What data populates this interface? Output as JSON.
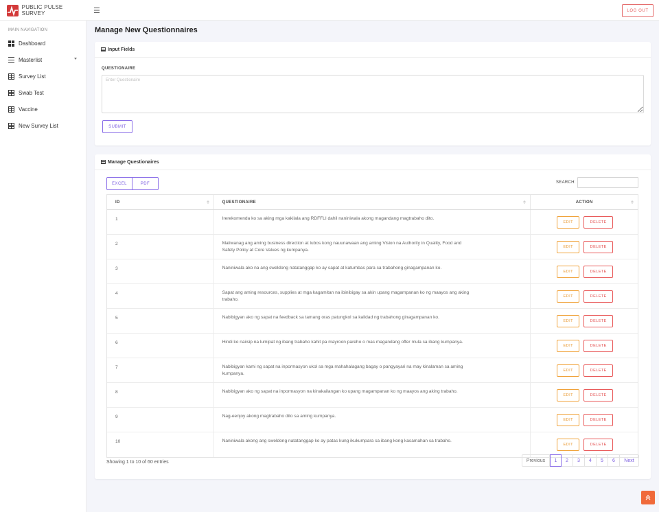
{
  "app": {
    "brand": "PUBLIC PULSE SURVEY",
    "logout_label": "LOG OUT",
    "colors": {
      "accent": "#7a5ce0",
      "brand": "#d33a3a",
      "edit": "#e8952a",
      "delete": "#e34d4d",
      "scroll_top": "#f06a3a"
    }
  },
  "sidebar": {
    "heading": "MAIN NAVIGATION",
    "items": [
      {
        "label": "Dashboard",
        "icon": "dashboard-icon"
      },
      {
        "label": "Masterlist",
        "icon": "list-icon"
      },
      {
        "label": "Survey List",
        "icon": "table-icon"
      },
      {
        "label": "Swab Test",
        "icon": "table-icon"
      },
      {
        "label": "Vaccine",
        "icon": "table-icon"
      },
      {
        "label": "New Survey List",
        "icon": "table-icon"
      }
    ]
  },
  "page": {
    "title": "Manage New Questionnaires"
  },
  "input_card": {
    "title": "Input Fields",
    "field_label": "QUESTIONAIRE",
    "placeholder": "Enter Questionaire",
    "submit_label": "SUBMIT"
  },
  "manage_card": {
    "title": "Manage Questionaires",
    "export_excel": "EXCEL",
    "export_pdf": "PDF",
    "search_label": "SEARCH:",
    "columns": [
      "ID",
      "QUESTIONAIRE",
      "ACTION"
    ],
    "edit_label": "EDIT",
    "delete_label": "DELETE",
    "rows": [
      {
        "id": "1",
        "q": "Irerekomenda ko sa aking mga kakilala ang RDFFLI dahil naniniwala akong magandang magtrabaho dito."
      },
      {
        "id": "2",
        "q": "Maliwanag ang aming business direction at lubos kong nauunawaan ang aming Vision na Authority in Quality, Food and Safety Policy at Core Values ng kumpanya."
      },
      {
        "id": "3",
        "q": "Naniniwala ako na ang sweldong natatanggap ko ay sapat at katumbas para sa trabahong ginagampanan ko."
      },
      {
        "id": "4",
        "q": "Sapat ang aming resources, supplies at mga kagamitan na ibinibigay sa akin upang magampanan ko ng maayos ang aking trabaho."
      },
      {
        "id": "5",
        "q": "Nabibigyan ako ng sapat na feedback sa tamang oras patungkol sa kalidad ng trabahong ginagampanan ko."
      },
      {
        "id": "6",
        "q": "Hindi ko naiisip na lumipat ng ibang trabaho kahit pa mayroon pareho o mas magandang offer mula sa ibang kumpanya."
      },
      {
        "id": "7",
        "q": "Nabibigyan kami ng sapat na inpormasyon ukol sa mga mahahalagang bagay o pangyayari na may kinalaman sa aming kumpanya."
      },
      {
        "id": "8",
        "q": "Nabibigyan ako ng sapat na inpormasyon na kinakailangan ko upang magampanan ko ng maayos ang aking trabaho."
      },
      {
        "id": "9",
        "q": "Nag-eenjoy akong magtrabaho dito sa aming kumpanya."
      },
      {
        "id": "10",
        "q": "Naniniwala akong ang sweldong natatanggap ko ay patas kung ikukumpara sa ibang kong kasamahan sa trabaho."
      }
    ],
    "info": "Showing 1 to 10 of 60 entries",
    "pagination": {
      "previous": "Previous",
      "next": "Next",
      "pages": [
        "1",
        "2",
        "3",
        "4",
        "5",
        "6"
      ],
      "current": "1"
    }
  }
}
